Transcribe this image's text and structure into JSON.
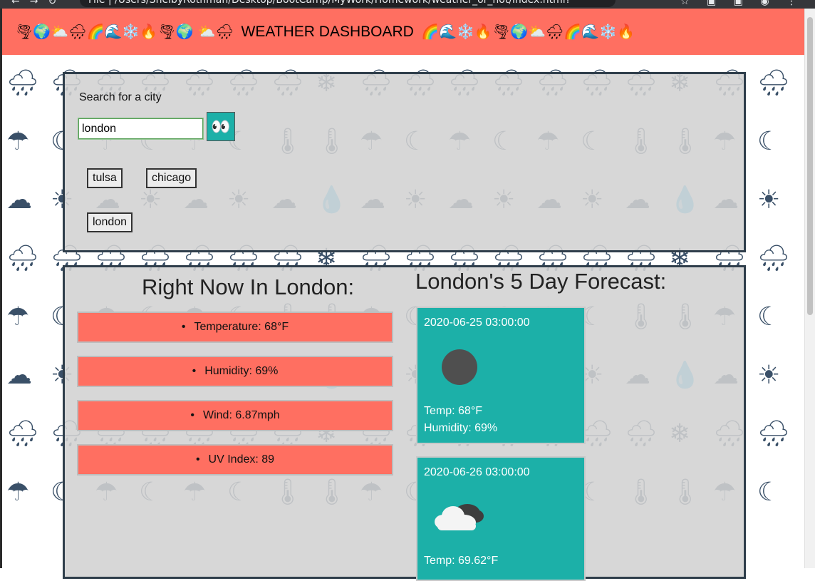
{
  "browser": {
    "url": "File  |  /Users/ShelbyRothman/Desktop/BootCamp/MyWork/Homework/weather_or_not/index.html?"
  },
  "header": {
    "left_emojis": "🌪🌍⛅🌧🌈🌊❄️🔥🌪🌍 ⛅🌧",
    "title": "WEATHER DASHBOARD",
    "right_emojis": "🌈🌊❄️🔥🌪🌍⛅🌧🌈🌊❄️🔥"
  },
  "search": {
    "label": "Search for a city",
    "input_value": "london",
    "button_icon": "eyes-icon",
    "button_glyph": "👀",
    "history": [
      "tulsa",
      "chicago",
      "london"
    ]
  },
  "current": {
    "title": "Right Now In London:",
    "bullet": "•",
    "stats": [
      "Temperature: 68°F",
      "Humidity: 69%",
      "Wind: 6.87mph",
      "UV Index: 89"
    ]
  },
  "forecast": {
    "title": "London's 5 Day Forecast:",
    "cards": [
      {
        "date": "2020-06-25 03:00:00",
        "icon": "moon-icon",
        "temp": "Temp: 68°F",
        "humidity": "Humidity: 69%"
      },
      {
        "date": "2020-06-26 03:00:00",
        "icon": "cloud-icon",
        "temp": "Temp: 69.62°F",
        "humidity": ""
      }
    ]
  },
  "colors": {
    "header": "#ff6f61",
    "stat_box": "#ff6f61",
    "card": "#1cb0a8",
    "panel_border": "#2f3e4b"
  }
}
